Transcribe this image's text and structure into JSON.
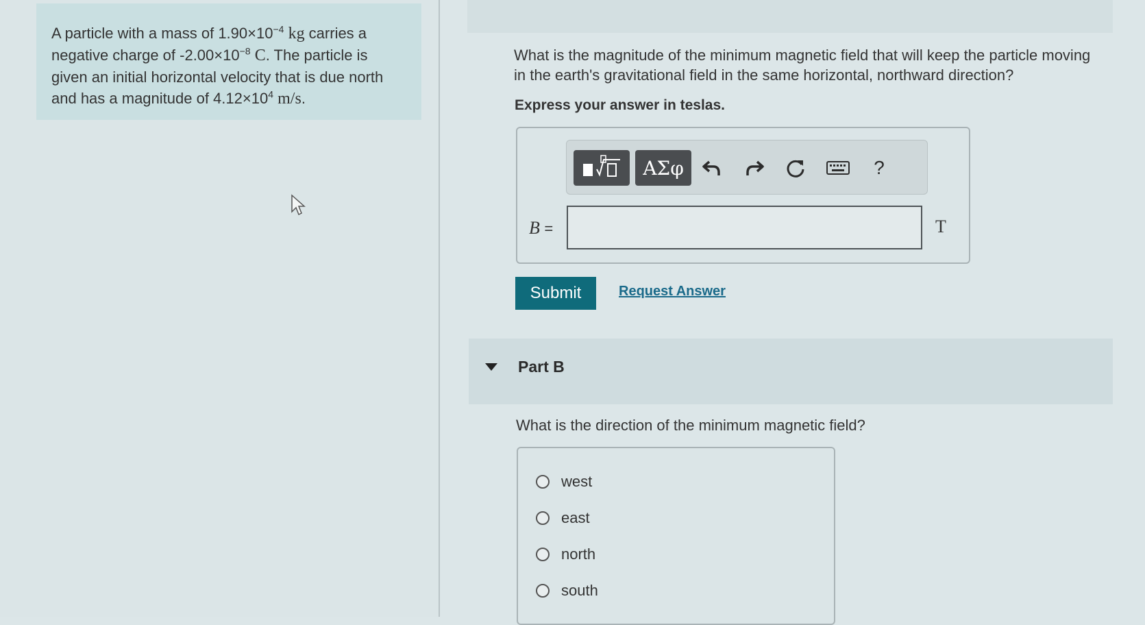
{
  "problem": {
    "text_1": "A particle with a mass of 1.90×10",
    "mass_exp": "−4",
    "mass_unit": "kg",
    "text_2": " carries a negative charge of -2.00×10",
    "charge_exp": "−8",
    "charge_unit": "C",
    "text_3": ". The particle is given an initial horizontal velocity that is due north and has a magnitude of 4.12×10",
    "velocity_exp": "4",
    "velocity_unit": "m/s",
    "text_4": "."
  },
  "partA": {
    "question": "What is the magnitude of the minimum magnetic field that will keep the particle moving in the earth's gravitational field in the same horizontal, northward direction?",
    "instruction": "Express your answer in teslas.",
    "toolbar": {
      "symbols_label": "ΑΣφ",
      "help_label": "?"
    },
    "variable": "B",
    "equals": "=",
    "input_value": "",
    "unit": "T",
    "submit_label": "Submit",
    "request_label": "Request Answer"
  },
  "partB": {
    "title": "Part B",
    "question": "What is the direction of the minimum magnetic field?",
    "options": [
      "west",
      "east",
      "north",
      "south"
    ]
  },
  "icons": {
    "templates": "templates-icon",
    "undo": "undo-icon",
    "redo": "redo-icon",
    "reset": "reset-icon",
    "keyboard": "keyboard-icon",
    "help": "help-icon",
    "cursor": "mouse-cursor-icon"
  },
  "colors": {
    "accent": "#0f6b7b",
    "link": "#1a6a8a",
    "background": "#dce6e8",
    "problem_box": "#c9dfe1"
  }
}
